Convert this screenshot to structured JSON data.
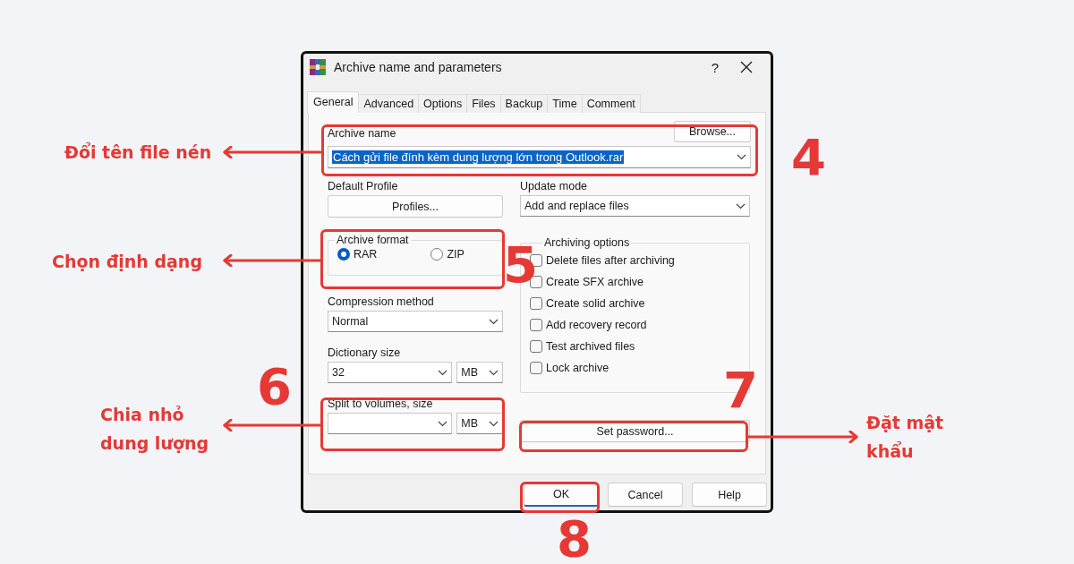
{
  "window": {
    "title": "Archive name and parameters",
    "help": "?"
  },
  "tabs": [
    {
      "label": "General",
      "selected": true
    },
    {
      "label": "Advanced",
      "selected": false
    },
    {
      "label": "Options",
      "selected": false
    },
    {
      "label": "Files",
      "selected": false
    },
    {
      "label": "Backup",
      "selected": false
    },
    {
      "label": "Time",
      "selected": false
    },
    {
      "label": "Comment",
      "selected": false
    }
  ],
  "archive_name": {
    "label": "Archive name",
    "value": "Cách gửi file đính kèm dung lượng lớn trong Outlook.rar",
    "text_selected": true,
    "browse": "Browse..."
  },
  "default_profile": {
    "label": "Default Profile",
    "button": "Profiles..."
  },
  "update_mode": {
    "label": "Update mode",
    "value": "Add and replace files"
  },
  "archive_format": {
    "label": "Archive format",
    "options": [
      {
        "label": "RAR",
        "selected": true
      },
      {
        "label": "ZIP",
        "selected": false
      }
    ]
  },
  "compression_method": {
    "label": "Compression method",
    "value": "Normal"
  },
  "dictionary_size": {
    "label": "Dictionary size",
    "value": "32",
    "unit": "MB"
  },
  "split_volumes": {
    "label": "Split to volumes, size",
    "unit": "MB"
  },
  "archiving_options": {
    "label": "Archiving options",
    "items": [
      {
        "label": "Delete files after archiving",
        "checked": false
      },
      {
        "label": "Create SFX archive",
        "checked": false
      },
      {
        "label": "Create solid archive",
        "checked": false
      },
      {
        "label": "Add recovery record",
        "checked": false
      },
      {
        "label": "Test archived files",
        "checked": false
      },
      {
        "label": "Lock archive",
        "checked": false
      }
    ]
  },
  "set_password": "Set password...",
  "buttons": [
    {
      "label": "OK",
      "default": true
    },
    {
      "label": "Cancel",
      "default": false
    },
    {
      "label": "Help",
      "default": false
    }
  ],
  "annotations": [
    {
      "number": "4",
      "label": "Đổi tên file nén"
    },
    {
      "number": "5",
      "label": "Chọn định dạng"
    },
    {
      "number": "6",
      "label": "Chia nhỏ dung lượng"
    },
    {
      "number": "7",
      "label": "Đặt mật khẩu"
    },
    {
      "number": "8"
    }
  ]
}
